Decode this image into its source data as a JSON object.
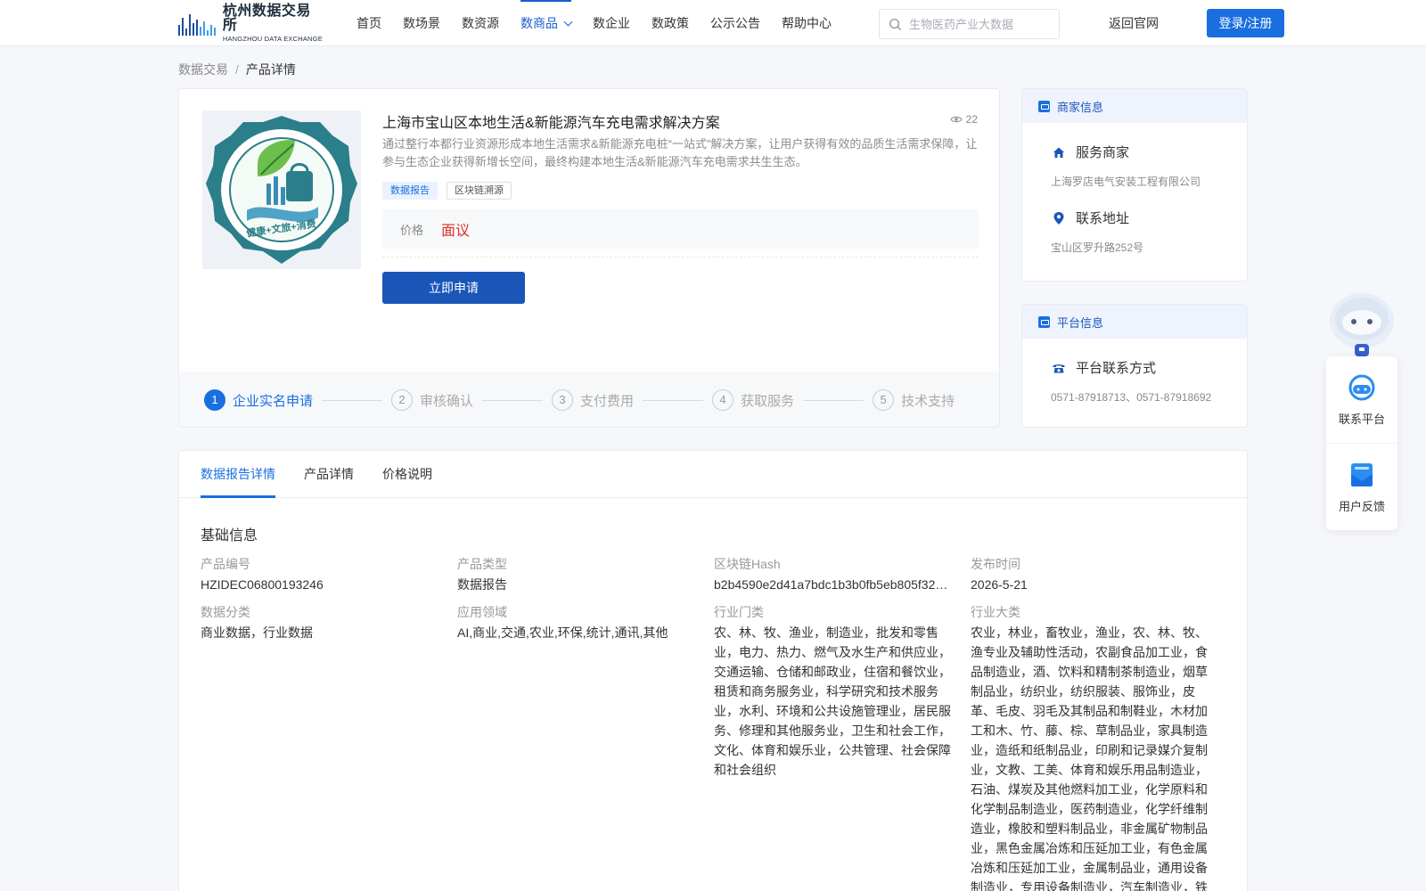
{
  "header": {
    "logo_cn": "杭州数据交易所",
    "logo_en": "HANGZHOU DATA EXCHANGE",
    "nav": [
      "首页",
      "数场景",
      "数资源",
      "数商品",
      "数企业",
      "数政策",
      "公示公告",
      "帮助中心"
    ],
    "nav_active_index": 3,
    "search_placeholder": "生物医药产业大数据",
    "back_link": "返回官网",
    "login": "登录/注册"
  },
  "breadcrumb": {
    "root": "数据交易",
    "sep": "/",
    "current": "产品详情"
  },
  "product": {
    "title": "上海市宝山区本地生活&新能源汽车充电需求解决方案",
    "views": "22",
    "description": "通过整行本都行业资源形成本地生活需求&新能源充电桩“一站式”解决方案，让用户获得有效的品质生活需求保障，让参与生态企业获得新增长空间，最终构建本地生活&新能源汽车充电需求共生生态。",
    "tags": [
      "数据报告",
      "区块链溯源"
    ],
    "price_label": "价格",
    "price_value": "面议",
    "apply_button": "立即申请",
    "logo_badge_text": "健康+文旅+消费",
    "steps": [
      {
        "num": "1",
        "label": "企业实名申请"
      },
      {
        "num": "2",
        "label": "审核确认"
      },
      {
        "num": "3",
        "label": "支付费用"
      },
      {
        "num": "4",
        "label": "获取服务"
      },
      {
        "num": "5",
        "label": "技术支持"
      }
    ],
    "active_step": 1
  },
  "merchant": {
    "header": "商家信息",
    "service_label": "服务商家",
    "service_value": "上海罗店电气安装工程有限公司",
    "address_label": "联系地址",
    "address_value": "宝山区罗升路252号"
  },
  "platform": {
    "header": "平台信息",
    "contact_label": "平台联系方式",
    "contact_value": "0571-87918713、0571-87918692"
  },
  "float": {
    "contact": "联系平台",
    "feedback": "用户反馈"
  },
  "detail": {
    "tabs": [
      "数据报告详情",
      "产品详情",
      "价格说明"
    ],
    "active_tab": 0,
    "section_title": "基础信息",
    "fields": [
      {
        "label": "产品编号",
        "value": "HZIDEC06800193246"
      },
      {
        "label": "产品类型",
        "value": "数据报告"
      },
      {
        "label": "区块链Hash",
        "value": "b2b4590e2d41a7bdc1b3b0fb5eb805f32e…"
      },
      {
        "label": "发布时间",
        "value": "2026-5-21"
      },
      {
        "label": "数据分类",
        "value": "商业数据，行业数据"
      },
      {
        "label": "应用领域",
        "value": "AI,商业,交通,农业,环保,统计,通讯,其他"
      },
      {
        "label": "行业门类",
        "value": "农、林、牧、渔业，制造业，批发和零售业，电力、热力、燃气及水生产和供应业，交通运输、仓储和邮政业，住宿和餐饮业，租赁和商务服务业，科学研究和技术服务业，水利、环境和公共设施管理业，居民服务、修理和其他服务业，卫生和社会工作，文化、体育和娱乐业，公共管理、社会保障和社会组织"
      },
      {
        "label": "行业大类",
        "value": "农业，林业，畜牧业，渔业，农、林、牧、渔专业及辅助性活动，农副食品加工业，食品制造业，酒、饮料和精制茶制造业，烟草制品业，纺织业，纺织服装、服饰业，皮革、毛皮、羽毛及其制品和制鞋业，木材加工和木、竹、藤、棕、草制品业，家具制造业，造纸和纸制品业，印刷和记录媒介复制业，文教、工美、体育和娱乐用品制造业，石油、煤炭及其他燃料加工业，化学原料和化学制品制造业，医药制造业，化学纤维制造业，橡胶和塑料制品业，非金属矿物制品业，黑色金属冶炼和压延加工业，有色金属冶炼和压延加工业，金属制品业，通用设备制造业，专用设备制造业，汽车制造业，铁"
      }
    ]
  },
  "colors": {
    "primary": "#1a6fe0",
    "dark_button": "#1a56b8",
    "price": "#e02e24"
  }
}
